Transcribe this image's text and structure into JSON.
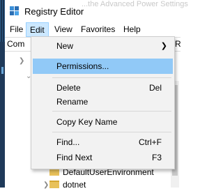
{
  "window": {
    "title": "Registry Editor",
    "ghost_text": "...the Advanced Power Settings"
  },
  "menubar": {
    "items": [
      "File",
      "Edit",
      "View",
      "Favorites",
      "Help"
    ],
    "active": "Edit"
  },
  "address": {
    "left_text": "Com",
    "right_text": "AR"
  },
  "edit_menu": {
    "items": [
      {
        "label": "New",
        "shortcut": "",
        "submenu": true,
        "highlighted": false
      },
      {
        "label": "Permissions...",
        "shortcut": "",
        "submenu": false,
        "highlighted": true
      },
      {
        "label": "Delete",
        "shortcut": "Del",
        "submenu": false,
        "highlighted": false
      },
      {
        "label": "Rename",
        "shortcut": "",
        "submenu": false,
        "highlighted": false
      },
      {
        "label": "Copy Key Name",
        "shortcut": "",
        "submenu": false,
        "highlighted": false
      },
      {
        "label": "Find...",
        "shortcut": "Ctrl+F",
        "submenu": false,
        "highlighted": false
      },
      {
        "label": "Find Next",
        "shortcut": "F3",
        "submenu": false,
        "highlighted": false
      }
    ]
  },
  "tree": {
    "visible_items": [
      "DefaultUserEnvironment",
      "dotnet"
    ]
  },
  "colors": {
    "menu_highlight": "#91c9f7",
    "menubar_active": "#cce8ff",
    "menu_background": "#f2f2f2"
  },
  "icons": {
    "app": "registry-editor-icon",
    "submenu": "chevron-right-icon",
    "tree_expand": "chevron-right-icon",
    "folder": "folder-icon"
  }
}
